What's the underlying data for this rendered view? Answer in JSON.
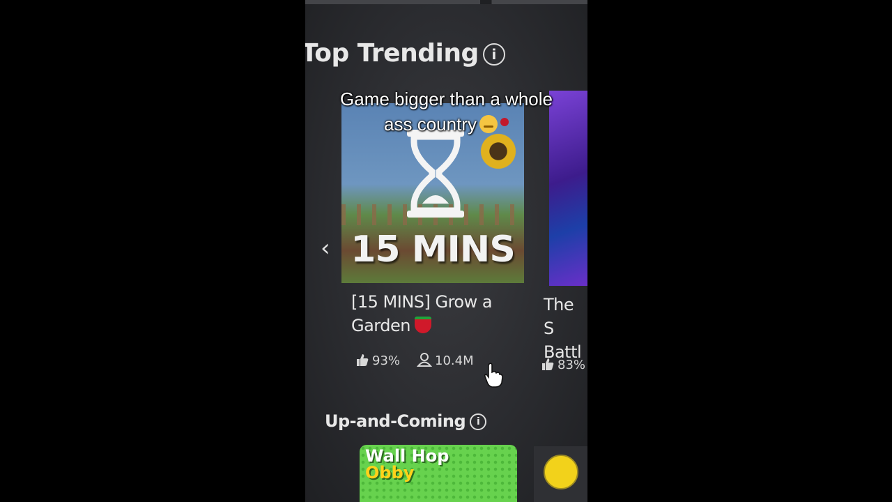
{
  "caption": {
    "line1": "Game bigger than a whole",
    "line2": "ass country"
  },
  "sections": {
    "top_trending": {
      "title": "Top Trending",
      "info_icon": "i"
    },
    "up_and_coming": {
      "title": "Up-and-Coming",
      "info_icon": "i"
    }
  },
  "games": [
    {
      "thumbnail_text": "15 MINS",
      "title_line1": "[15 MINS] Grow a",
      "title_line2": "Garden",
      "like_ratio": "93%",
      "players": "10.4M"
    },
    {
      "title_line1": "The S",
      "title_line2": "Battl",
      "like_ratio": "83%"
    }
  ],
  "upcoming": [
    {
      "thumbnail_line1": "Wall Hop",
      "thumbnail_line2": "Obby"
    }
  ],
  "colors": {
    "background": "#000000",
    "page": "#2b2c30",
    "text": "#e8e8e8",
    "accent_green": "#67d24e"
  },
  "icons": [
    "info-icon",
    "chevron-left-icon",
    "thumbs-up-icon",
    "person-icon",
    "hand-cursor-icon",
    "hourglass-icon"
  ]
}
